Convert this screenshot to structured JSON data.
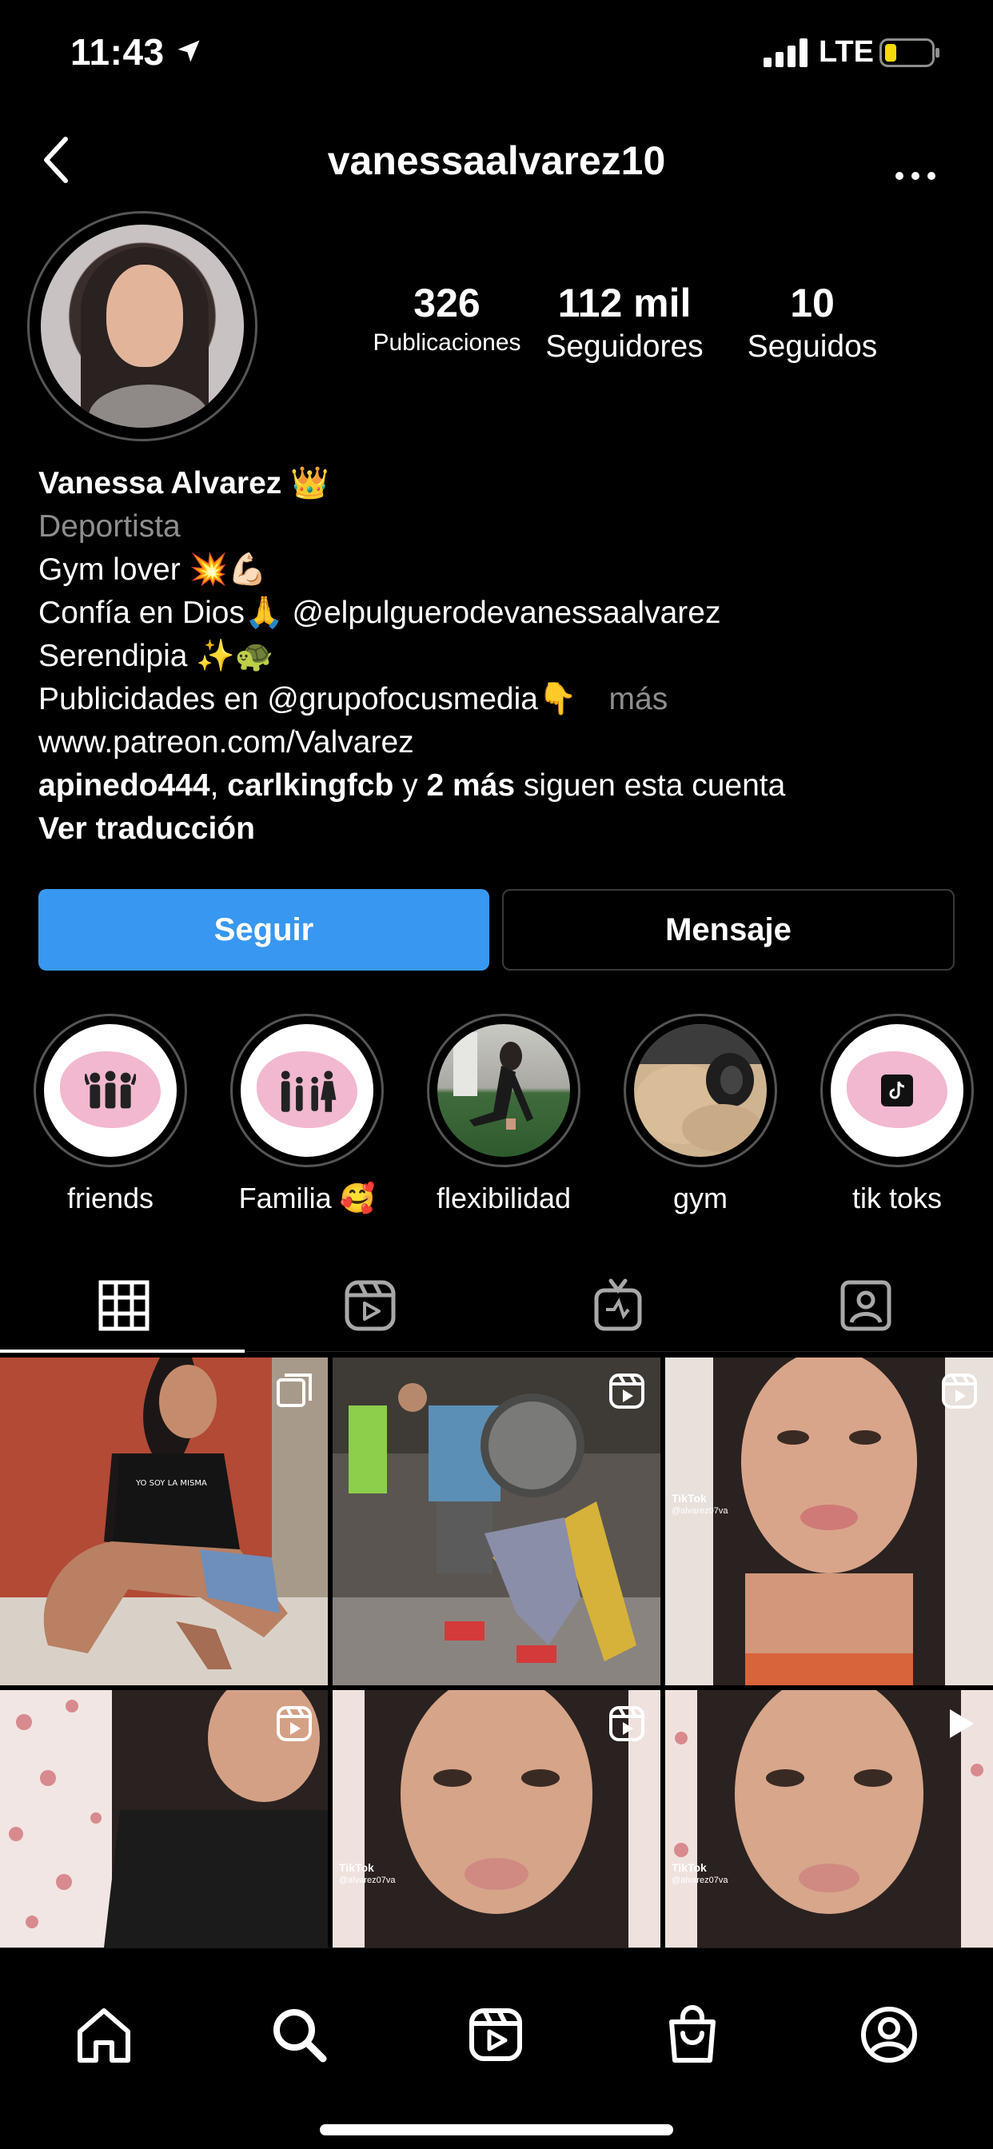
{
  "status_bar": {
    "time": "11:43",
    "network": "LTE"
  },
  "header": {
    "username": "vanessaalvarez10"
  },
  "stats": [
    {
      "value": "326",
      "label": "Publicaciones"
    },
    {
      "value": "112 mil",
      "label": "Seguidores"
    },
    {
      "value": "10",
      "label": "Seguidos"
    }
  ],
  "bio": {
    "name": "Vanessa Alvarez 👑",
    "category": "Deportista",
    "lines": [
      "Gym lover 💥💪🏻",
      "Confía en Dios🙏 @elpulguerodevanessaalvarez",
      "Serendipia ✨🐢",
      "Publicidades en @grupofocusmedia👇"
    ],
    "more": "más",
    "link": "www.patreon.com/Valvarez",
    "followed_by": {
      "user1": "apinedo444",
      "sep": ", ",
      "user2": "carlkingfcb",
      "and": " y ",
      "others": "2 más",
      "tail": " siguen esta cuenta"
    },
    "translate": "Ver traducción"
  },
  "buttons": {
    "follow": "Seguir",
    "message": "Mensaje"
  },
  "highlights": [
    {
      "label": "friends",
      "icon": "friends-icon"
    },
    {
      "label": "Familia 🥰",
      "icon": "family-icon"
    },
    {
      "label": "flexibilidad",
      "icon": "photo"
    },
    {
      "label": "gym",
      "icon": "photo"
    },
    {
      "label": "tik toks",
      "icon": "tiktok-icon"
    }
  ],
  "tabs": [
    "grid-icon",
    "reels-icon",
    "igtv-icon",
    "tagged-icon"
  ],
  "posts": [
    {
      "type": "carousel"
    },
    {
      "type": "reel"
    },
    {
      "type": "reel",
      "overlay": "TikTok",
      "handle": "@alvarez07va"
    },
    {
      "type": "reel"
    },
    {
      "type": "reel",
      "overlay": "TikTok",
      "handle": "@alvarez07va"
    },
    {
      "type": "video",
      "overlay": "TikTok",
      "handle": "@alvarez07va"
    }
  ],
  "post_shirt_text": "YO SOY LA MISMA",
  "nav": [
    "home-icon",
    "search-icon",
    "reels-icon",
    "shop-icon",
    "profile-icon"
  ],
  "colors": {
    "accent": "#3897f0",
    "muted": "#8e8e8e",
    "battery": "#f5d90a"
  }
}
